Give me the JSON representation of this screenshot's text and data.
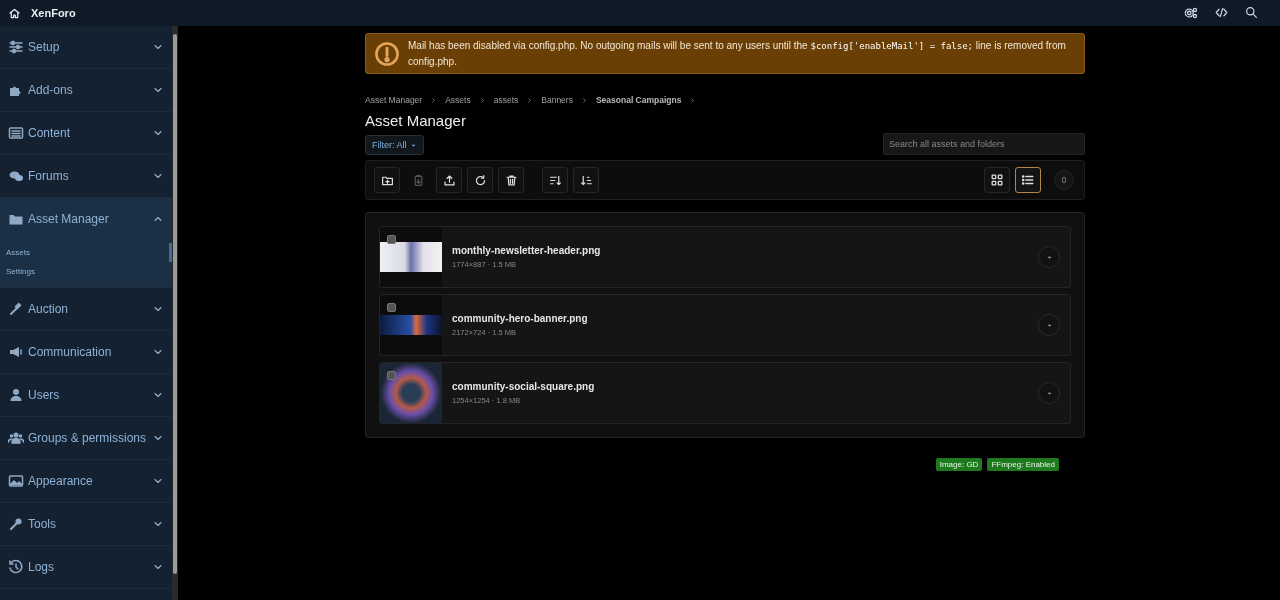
{
  "topbar": {
    "title": "XenForo"
  },
  "sidebar": {
    "items": [
      {
        "label": "Setup",
        "expanded": false,
        "selected": false
      },
      {
        "label": "Add-ons",
        "expanded": false,
        "selected": false
      },
      {
        "label": "Content",
        "expanded": false,
        "selected": false
      },
      {
        "label": "Forums",
        "expanded": false,
        "selected": false
      },
      {
        "label": "Asset Manager",
        "expanded": true,
        "selected": true,
        "children": [
          {
            "label": "Assets",
            "selected": true
          },
          {
            "label": "Settings",
            "selected": false
          }
        ]
      },
      {
        "label": "Auction",
        "expanded": false,
        "selected": false
      },
      {
        "label": "Communication",
        "expanded": false,
        "selected": false
      },
      {
        "label": "Users",
        "expanded": false,
        "selected": false
      },
      {
        "label": "Groups & permissions",
        "expanded": false,
        "selected": false
      },
      {
        "label": "Appearance",
        "expanded": false,
        "selected": false
      },
      {
        "label": "Tools",
        "expanded": false,
        "selected": false
      },
      {
        "label": "Logs",
        "expanded": false,
        "selected": false
      }
    ]
  },
  "notice": {
    "message": [
      {
        "kind": "text",
        "text": "Mail has been disabled via config.php. No outgoing mails will be sent to any users until the "
      },
      {
        "kind": "code",
        "text": "$config['enableMail'] = false;"
      },
      {
        "kind": "text",
        "text": " line is removed from config.php."
      }
    ]
  },
  "breadcrumbs": [
    "Asset Manager",
    "Assets",
    "assets",
    "Banners",
    "Seasonal Campaigns"
  ],
  "page_title": "Asset Manager",
  "filter": {
    "label": "Filter: All"
  },
  "search": {
    "placeholder": "Search all assets and folders"
  },
  "toolbar": {
    "actions": [
      {
        "disabled": false
      },
      {
        "disabled": true
      },
      {
        "disabled": false
      },
      {
        "disabled": false
      },
      {
        "disabled": false
      },
      {
        "disabled": false
      },
      {
        "disabled": false
      }
    ],
    "views": [
      {
        "selected": false
      },
      {
        "selected": true
      }
    ],
    "count": "0"
  },
  "files": [
    {
      "name": "monthly-newsletter-header.png",
      "meta": "1774×887 · 1.5 MB",
      "checked": false
    },
    {
      "name": "community-hero-banner.png",
      "meta": "2172×724 · 1.5 MB",
      "checked": false
    },
    {
      "name": "community-social-square.png",
      "meta": "1254×1254 · 1.8 MB",
      "checked": false
    }
  ],
  "badges": [
    "Image: GD",
    "FFmpeg: Enabled"
  ]
}
